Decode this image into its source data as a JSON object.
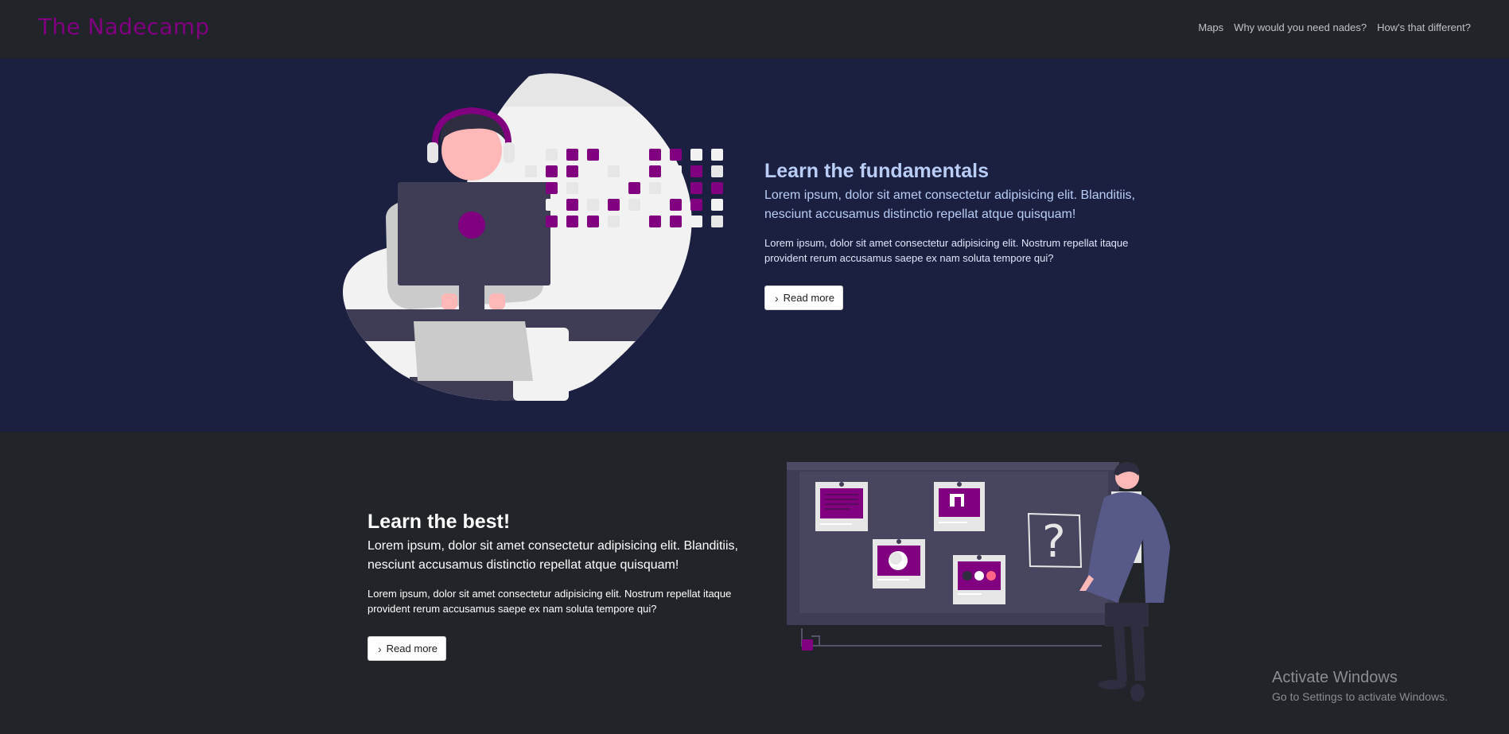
{
  "nav": {
    "brand": "The Nadecamp",
    "links": [
      "Maps",
      "Why would you need nades?",
      "How's that different?"
    ]
  },
  "section1": {
    "title": "Learn the fundamentals",
    "lead": "Lorem ipsum, dolor sit amet consectetur adipisicing elit. Blanditiis, nesciunt accusamus distinctio repellat atque quisquam!",
    "body": "Lorem ipsum, dolor sit amet consectetur adipisicing elit. Nostrum repellat itaque provident rerum accusamus saepe ex nam soluta tempore qui?",
    "button": "Read more"
  },
  "section2": {
    "title": "Learn the best!",
    "lead": "Lorem ipsum, dolor sit amet consectetur adipisicing elit. Blanditiis, nesciunt accusamus distinctio repellat atque quisquam!",
    "body": "Lorem ipsum, dolor sit amet consectetur adipisicing elit. Nostrum repellat itaque provident rerum accusamus saepe ex nam soluta tempore qui?",
    "button": "Read more"
  },
  "watermark": {
    "title": "Activate Windows",
    "subtitle": "Go to Settings to activate Windows."
  },
  "colors": {
    "brand": "#800080",
    "section1_bg": "#1b2040",
    "page_bg": "#212429",
    "title1": "#b9cdf6"
  },
  "icons": {
    "button_icon": "chevron-right-icon"
  }
}
